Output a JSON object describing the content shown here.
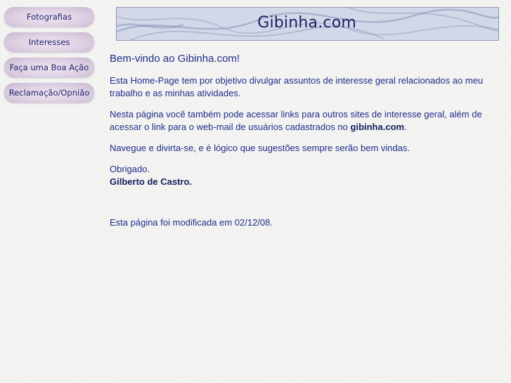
{
  "nav": {
    "items": [
      {
        "label": "Fotografias"
      },
      {
        "label": "Interesses"
      },
      {
        "label": "Faça uma Boa Ação"
      },
      {
        "label": "Reclamação/Opnião"
      }
    ]
  },
  "banner": {
    "title": "Gibinha.com"
  },
  "content": {
    "welcome": "Bem-vindo ao Gibinha.com!",
    "p1": "Esta Home-Page tem por objetivo divulgar assuntos de interesse geral relacionados ao meu trabalho e as minhas atividades.",
    "p2_prefix": "Nesta página você também pode acessar links para outros sites de interesse geral, além de acessar o link para o web-mail de usuários cadastrados no ",
    "p2_link": "gibinha.com",
    "p2_suffix": ".",
    "p3": "Navegue e divirta-se, e é lógico que sugestões sempre serão bem vindas.",
    "thanks": "Obrigado.",
    "signature": "Gilberto de Castro.",
    "modified": "Esta página foi modificada em 02/12/08."
  },
  "colors": {
    "text": "#1f2d8a",
    "banner_bg": "#d3d8e8",
    "button_bg": "#ddd0e3"
  }
}
